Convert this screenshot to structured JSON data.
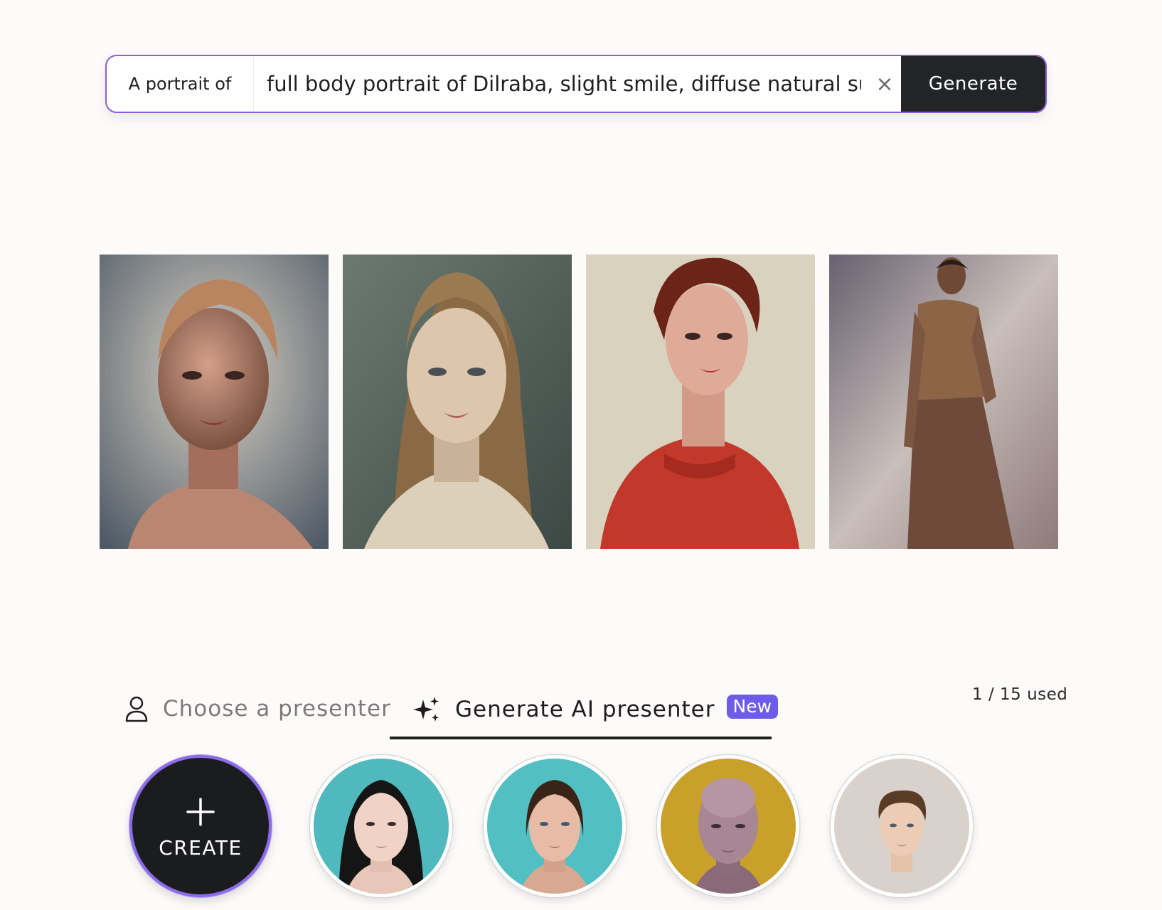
{
  "prompt": {
    "prefix": "A portrait of",
    "value": "full body portrait of Dilraba, slight smile, diffuse natural sun l",
    "clear_icon": "close-icon",
    "generate_label": "Generate"
  },
  "results": [
    {
      "description": "portrait-1"
    },
    {
      "description": "portrait-2"
    },
    {
      "description": "portrait-3"
    },
    {
      "description": "portrait-4"
    }
  ],
  "tabs": {
    "choose_label": "Choose a presenter",
    "choose_icon": "user-icon",
    "generate_label": "Generate AI presenter",
    "generate_icon": "sparkles-icon",
    "generate_badge": "New",
    "active": "generate"
  },
  "usage_text": "1 / 15 used",
  "presenters": {
    "create_label": "CREATE",
    "create_icon": "plus-icon"
  },
  "colors": {
    "accent": "#8e5bd9",
    "badge": "#6d5bea",
    "button_dark": "#222426"
  }
}
